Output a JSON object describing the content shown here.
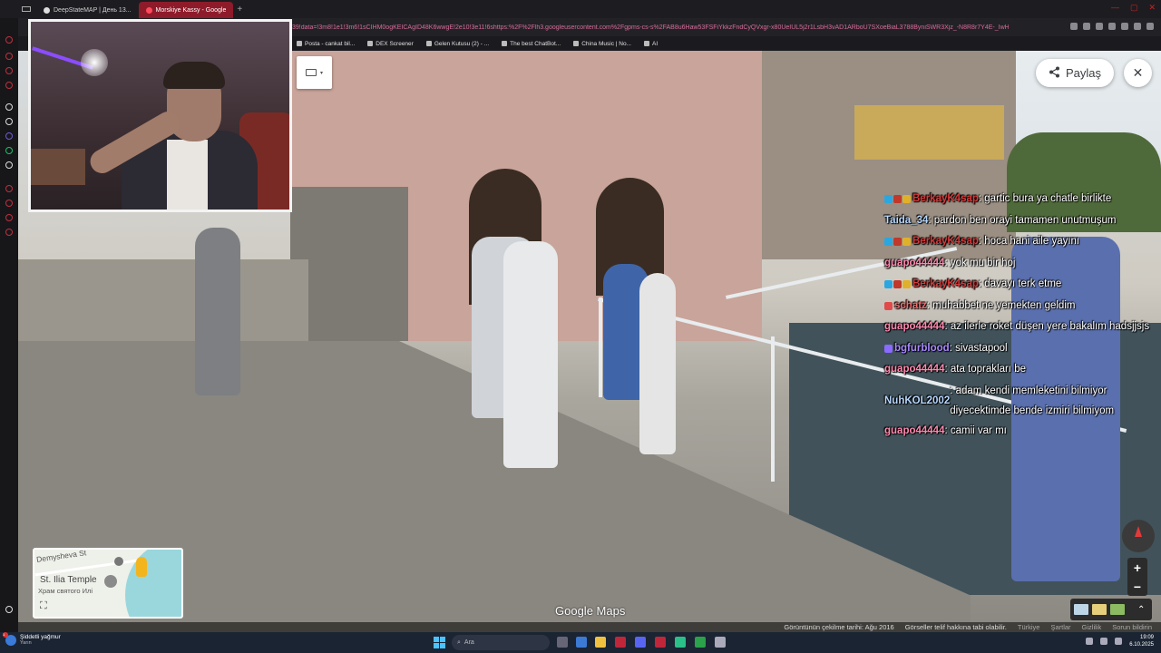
{
  "browser": {
    "tabs": [
      {
        "label": "DeepStateMAP | День 13...",
        "active": false
      },
      {
        "label": "Morskiye Kassy - Google",
        "active": true
      }
    ],
    "new_tab_symbol": "+",
    "url": "39!data=!3m8!1e1!3m6!1sCIHM0ogKEICAgID48K6wwgE!2e10!3e11!6shttps:%2F%2Flh3.googleusercontent.com%2Fgpms-cs-s%2FAB8u6Haw53FSFiYkkzFndCyQVxgr-x80UeIUL5j2r1LsbH3vAD1ARboU7SXoeBiaL3788ByniSWR3Xjz_-N8R8r7Y4E-_IwHmsv",
    "bookmarks": [
      "Posta - cankat bil...",
      "DEX Screener",
      "Gelen Kutusu (2) - ...",
      "The best ChatBot...",
      "China Music | No...",
      "AI"
    ]
  },
  "streetview": {
    "share_label": "Paylaş",
    "close_symbol": "✕",
    "keyboard_arrow": "▾",
    "zoom_in": "+",
    "zoom_out": "−",
    "google_maps_logo": "Google Maps",
    "layers_chevron": "⌃"
  },
  "minimap": {
    "street_label": "Demyshevа St",
    "place_label": "St. Ilia Temple",
    "place_label_ru": "Храм святого Илі",
    "expand_symbol": "⛶"
  },
  "footer": {
    "capture_date": "Görüntünün çekilme tarihi: Ağu 2016",
    "copyright": "Görseller telif hakkına tabi olabilir.",
    "country": "Türkiye",
    "terms": "Şartlar",
    "privacy": "Gizlilik",
    "report": "Sorun bildirin"
  },
  "chat": [
    {
      "user": "BerkayK4sap",
      "text": ": gartic bura ya chatle birlikte",
      "color": "#d83a3a",
      "badges": [
        "#2aa7e0",
        "#c0392b",
        "#e0b02a"
      ]
    },
    {
      "user": "Taida_34",
      "text": ": pardon ben orayi tamamen unutmuşum",
      "color": "#b8d8ff",
      "badges": []
    },
    {
      "user": "BerkayK4sap",
      "text": ": hoca hani aile yayını",
      "color": "#d83a3a",
      "badges": [
        "#2aa7e0",
        "#c0392b",
        "#e0b02a"
      ]
    },
    {
      "user": "guapo44444",
      "text": ": yok mu bir hoj",
      "color": "#ff8ab0",
      "badges": []
    },
    {
      "user": "BerkayK4sap",
      "text": ": davayı terk etme",
      "color": "#d83a3a",
      "badges": [
        "#2aa7e0",
        "#c0392b",
        "#e0b02a"
      ]
    },
    {
      "user": "schatz",
      "text": ": muhabbet ne yemekten geldim",
      "color": "#ff6a6a",
      "badges": [
        "#e04a4a"
      ]
    },
    {
      "user": "guapo44444",
      "text": ": az ilerle roket düşen yere bakalım hadsjjsjs",
      "color": "#ff8ab0",
      "badges": []
    },
    {
      "user": "bgfurblood",
      "text": ": sivastapool",
      "color": "#a98aff",
      "badges": [
        "#8a6aff"
      ]
    },
    {
      "user": "guapo44444",
      "text": ": ata toprakları be",
      "color": "#ff8ab0",
      "badges": []
    },
    {
      "user": "NuhKOL2002",
      "text": ": adam kendi memleketini bilmiyor diyecektimde bende izmiri bilmiyom",
      "color": "#b8d8ff",
      "badges": []
    },
    {
      "user": "guapo44444",
      "text": ": camii var mı",
      "color": "#ff8ab0",
      "badges": []
    }
  ],
  "taskbar": {
    "weather_title": "Şiddetli yağmur",
    "weather_sub": "Yarın",
    "search_placeholder": "Ara",
    "time": "19:09",
    "date": "6.10.2025"
  }
}
